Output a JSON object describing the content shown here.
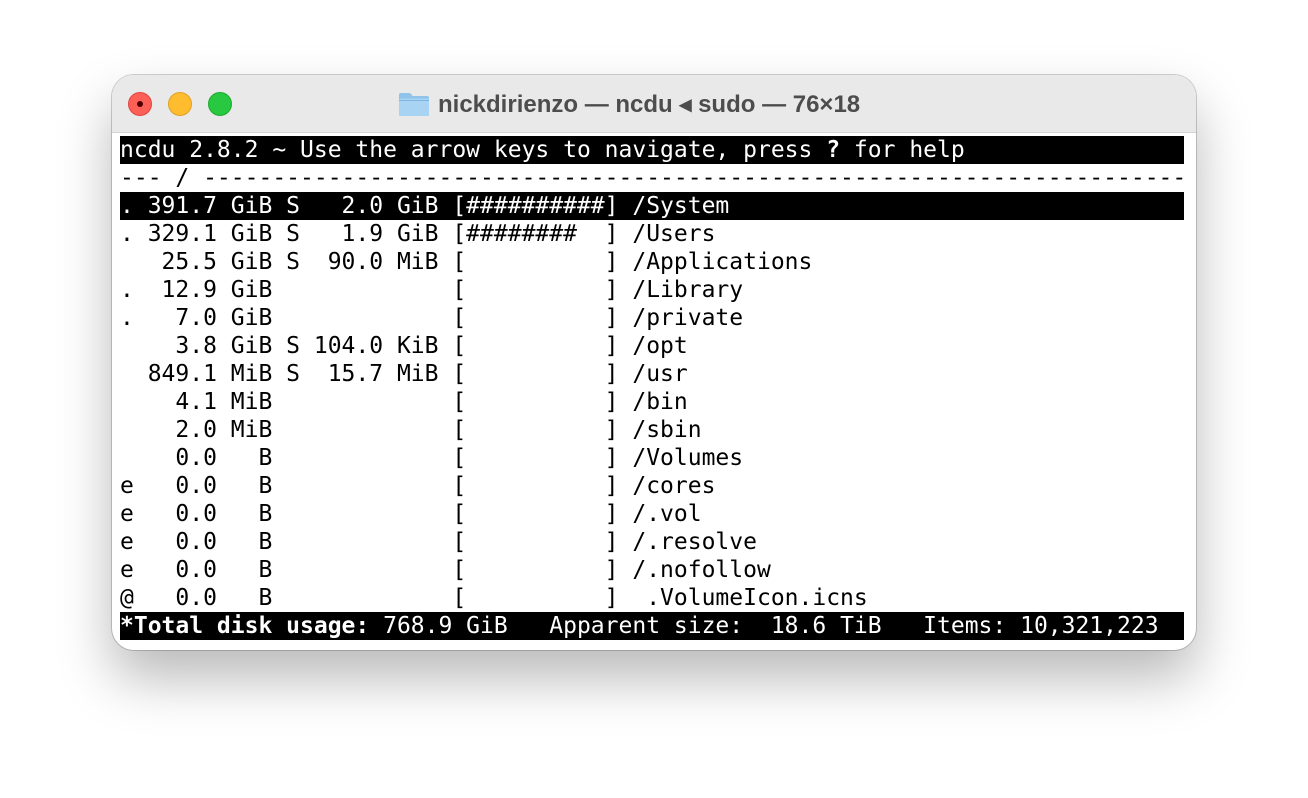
{
  "window": {
    "title": "nickdirienzo — ncdu ◂ sudo — 76×18",
    "folder_icon": "folder-icon"
  },
  "colors": {
    "titlebar": "#e9e9e9",
    "close": "#fe5f57",
    "minimize": "#febc2e",
    "maximize": "#28c840",
    "terminal_fg": "#000000",
    "terminal_bg": "#ffffff",
    "inverted_bg": "#000000",
    "inverted_fg": "#ffffff"
  },
  "header": {
    "pre": "ncdu 2.8.2 ~ Use the arrow keys to navigate, press ",
    "key": "?",
    "post": " for help"
  },
  "path_line": "--- / -----------------------------------------------------------------------",
  "entries": [
    {
      "text": ". 391.7 GiB S   2.0 GiB [##########] /System"
    },
    {
      "text": ". 329.1 GiB S   1.9 GiB [########  ] /Users"
    },
    {
      "text": "   25.5 GiB S  90.0 MiB [          ] /Applications"
    },
    {
      "text": ".  12.9 GiB             [          ] /Library"
    },
    {
      "text": ".   7.0 GiB             [          ] /private"
    },
    {
      "text": "    3.8 GiB S 104.0 KiB [          ] /opt"
    },
    {
      "text": "  849.1 MiB S  15.7 MiB [          ] /usr"
    },
    {
      "text": "    4.1 MiB             [          ] /bin"
    },
    {
      "text": "    2.0 MiB             [          ] /sbin"
    },
    {
      "text": "    0.0   B             [          ] /Volumes"
    },
    {
      "text": "e   0.0   B             [          ] /cores"
    },
    {
      "text": "e   0.0   B             [          ] /.vol"
    },
    {
      "text": "e   0.0   B             [          ] /.resolve"
    },
    {
      "text": "e   0.0   B             [          ] /.nofollow"
    },
    {
      "text": "@   0.0   B             [          ]  .VolumeIcon.icns"
    }
  ],
  "footer": {
    "total_label": "*Total disk usage:",
    "total_value": " 768.9 GiB   ",
    "apparent_label": "Apparent size:",
    "apparent_value": "  18.6 TiB   ",
    "items_label": "Items:",
    "items_value": " 10,321,223"
  }
}
